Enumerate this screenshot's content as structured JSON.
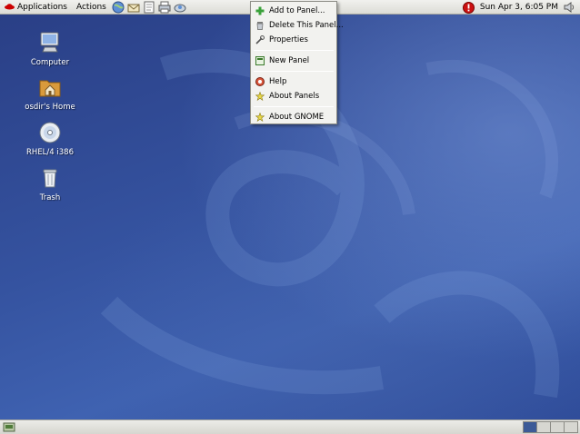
{
  "top_panel": {
    "applications_label": "Applications",
    "actions_label": "Actions",
    "launchers": [
      "web-browser-icon",
      "email-icon",
      "text-editor-icon",
      "printer-icon",
      "network-icon"
    ],
    "clock": "Sun Apr  3,  6:05 PM",
    "update_alert_icon": "alert-icon",
    "volume_icon": "volume-icon"
  },
  "desktop": {
    "icons": [
      {
        "label": "Computer",
        "icon": "computer-icon"
      },
      {
        "label": "osdir's Home",
        "icon": "home-folder-icon"
      },
      {
        "label": "RHEL/4 i386",
        "icon": "cdrom-icon"
      },
      {
        "label": "Trash",
        "icon": "trash-icon"
      }
    ]
  },
  "panel_menu": {
    "items": [
      {
        "label": "Add to Panel...",
        "icon": "plus-icon"
      },
      {
        "label": "Delete This Panel...",
        "icon": "delete-icon"
      },
      {
        "label": "Properties",
        "icon": "properties-icon"
      },
      {
        "label": "New Panel",
        "icon": "new-panel-icon"
      },
      {
        "label": "Help",
        "icon": "help-icon"
      },
      {
        "label": "About Panels",
        "icon": "star-icon"
      },
      {
        "label": "About GNOME",
        "icon": "gnome-star-icon"
      }
    ]
  },
  "bottom_panel": {
    "workspace_count": 4,
    "active_workspace": 1
  },
  "colors": {
    "panel_bg": "#e5e5e0",
    "desktop_blue": "#3553a0",
    "alert_red": "#cc1111",
    "active_workspace": "#3c5a97"
  }
}
